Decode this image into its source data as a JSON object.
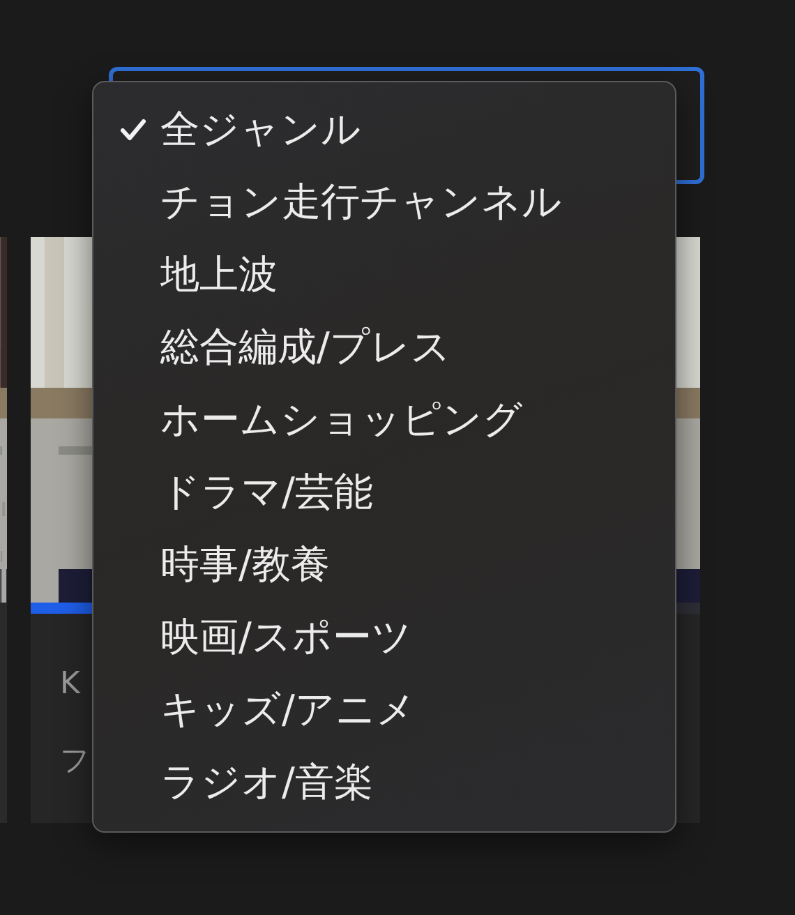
{
  "genre_select": {
    "focused": true
  },
  "genre_menu": {
    "items": [
      {
        "label": "全ジャンル",
        "selected": true
      },
      {
        "label": "チョン走行チャンネル",
        "selected": false
      },
      {
        "label": "地上波",
        "selected": false
      },
      {
        "label": "総合編成/プレス",
        "selected": false
      },
      {
        "label": "ホームショッピング",
        "selected": false
      },
      {
        "label": "ドラマ/芸能",
        "selected": false
      },
      {
        "label": "時事/教養",
        "selected": false
      },
      {
        "label": "映画/スポーツ",
        "selected": false
      },
      {
        "label": "キッズ/アニメ",
        "selected": false
      },
      {
        "label": "ラジオ/音楽",
        "selected": false
      }
    ]
  },
  "video_card": {
    "title": "K",
    "subtitle": "フ",
    "progress": {
      "level": 0.3
    }
  }
}
